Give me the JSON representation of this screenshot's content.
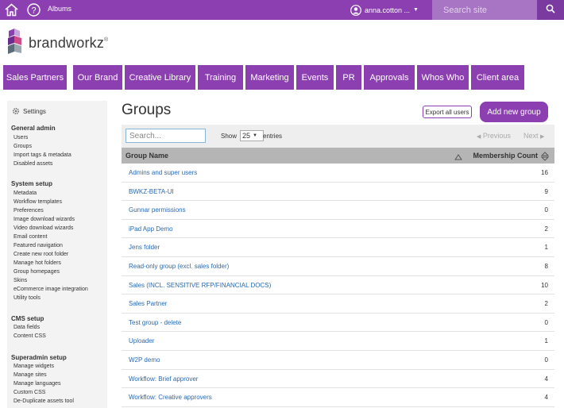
{
  "topbar": {
    "albums_label": "Albums",
    "user_name": "anna.cotton ...",
    "search_placeholder": "Search site",
    "icons": [
      "home-icon",
      "help-icon",
      "user-icon",
      "search-icon"
    ],
    "accent": "#8b3fb0"
  },
  "logo": {
    "text": "brandworkz"
  },
  "nav": {
    "items": [
      "Sales Partners",
      "Our Brand",
      "Creative Library",
      "Training",
      "Marketing",
      "Events",
      "PR",
      "Approvals",
      "Whos Who",
      "Client area"
    ]
  },
  "sidebar": {
    "settings_label": "Settings",
    "sections": [
      {
        "title": "General admin",
        "links": [
          "Users",
          "Groups",
          "Import tags & metadata",
          "Disabled assets"
        ]
      },
      {
        "title": "System setup",
        "links": [
          "Metadata",
          "Workflow templates",
          "Preferences",
          "Image download wizards",
          "Video download wizards",
          "Email content",
          "Featured navigation",
          "Create new root folder",
          "Manage hot folders",
          "Group homepages",
          "Skins",
          "eCommerce image integration",
          "Utility tools"
        ]
      },
      {
        "title": "CMS setup",
        "links": [
          "Data fields",
          "Content CSS"
        ]
      },
      {
        "title": "Superadmin setup",
        "links": [
          "Manage widgets",
          "Manage sites",
          "Manage languages",
          "Custom CSS",
          "De-Duplicate assets tool"
        ]
      }
    ]
  },
  "main": {
    "title": "Groups",
    "export_label": "Export all users",
    "add_label": "Add new group",
    "search_placeholder": "Search...",
    "show_label": "Show",
    "page_size": "25",
    "entries_label": "entries",
    "prev_label": "Previous",
    "next_label": "Next",
    "columns": [
      "Group Name",
      "Membership Count"
    ],
    "rows": [
      {
        "name": "Admins and super users",
        "count": "16"
      },
      {
        "name": "BWKZ-BETA-UI",
        "count": "9"
      },
      {
        "name": "Gunnar permissions",
        "count": "0"
      },
      {
        "name": "iPad App Demo",
        "count": "2"
      },
      {
        "name": "Jens folder",
        "count": "1"
      },
      {
        "name": "Read-only group (excl. sales folder)",
        "count": "8"
      },
      {
        "name": "Sales (INCL. SENSITIVE RFP/FINANCIAL DOCS)",
        "count": "10"
      },
      {
        "name": "Sales Partner",
        "count": "2"
      },
      {
        "name": "Test group - delete",
        "count": "0"
      },
      {
        "name": "Uploader",
        "count": "1"
      },
      {
        "name": "W2P demo",
        "count": "0"
      },
      {
        "name": "Workflow: Brief approver",
        "count": "4"
      },
      {
        "name": "Workflow: Creative approvers",
        "count": "4"
      }
    ]
  }
}
